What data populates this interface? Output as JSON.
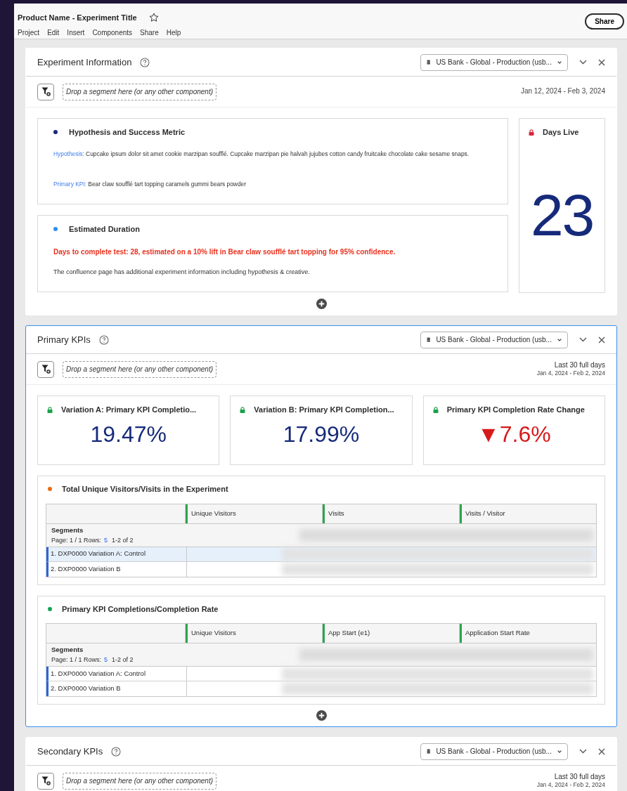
{
  "header": {
    "title": "Product Name - Experiment Title",
    "starred": false,
    "menu": [
      "Project",
      "Edit",
      "Insert",
      "Components",
      "Share",
      "Help"
    ],
    "share_button": "Share"
  },
  "panels": [
    {
      "kind": "info",
      "title": "Experiment Information",
      "selected": false,
      "data_source": "US Bank - Global - Production (usb...",
      "segment_drop": "Drop a segment here (or any other component)",
      "date_range": "Jan 12, 2024 - Feb 3, 2024",
      "cards": [
        {
          "title": "Hypothesis and Success Metric",
          "color": "#1b2a78",
          "lines": [
            {
              "label": "Hypothesis:",
              "text": "Cupcake ipsum dolor sit amet cookie marzipan soufflé. Cupcake marzipan pie halvah jujubes cotton candy fruitcake chocolate cake sesame snaps."
            },
            {
              "label": "Primary KPI:",
              "text": "Bear claw soufflé tart topping caramels gummi bears powder"
            }
          ]
        },
        {
          "title": "Estimated Duration",
          "color": "#2d8ff0",
          "alert": "Days to complete test: 28, estimated on a 10% lift in Bear claw soufflé tart topping for 95% confidence.",
          "note": "The confluence page has additional experiment information including hypothesis & creative."
        }
      ],
      "days_live": {
        "title": "Days Live",
        "value": "23"
      }
    },
    {
      "kind": "kpis",
      "title": "Primary KPIs",
      "selected": true,
      "data_source": "US Bank - Global - Production (usb...",
      "segment_drop": "Drop a segment here (or any other component)",
      "date_label": "Last 30 full days",
      "date_range": "Jan 4, 2024 - Feb 2, 2024",
      "metrics": [
        {
          "title": "Variation A: Primary KPI Completio...",
          "value": "19.47%",
          "color": "#162a7a"
        },
        {
          "title": "Variation B: Primary KPI Completion...",
          "value": "17.99%",
          "color": "#162a7a"
        },
        {
          "title": "Primary KPI Completion Rate Change",
          "value": "▼7.6%",
          "color": "#d71a1a"
        }
      ],
      "tables": [
        {
          "title": "Total Unique Visitors/Visits in the Experiment",
          "color": "#ee6a10",
          "columns": [
            "Unique Visitors",
            "Visits",
            "Visits / Visitor"
          ],
          "row_header": "Segments",
          "pager": "Page: 1 / 1 Rows:",
          "rows_count": "5",
          "range": "1-2 of 2",
          "rows": [
            {
              "label": "1.  DXP0000 Variation A: Control",
              "selected": true
            },
            {
              "label": "2.  DXP0000 Variation B",
              "selected": false
            }
          ]
        },
        {
          "title": "Primary KPI Completions/Completion Rate",
          "color": "#14a356",
          "columns": [
            "Unique Visitors",
            "App Start (e1)",
            "Application Start Rate"
          ],
          "row_header": "Segments",
          "pager": "Page: 1 / 1 Rows:",
          "rows_count": "5",
          "range": "1-2 of 2",
          "rows": [
            {
              "label": "1.  DXP0000 Variation A: Control",
              "selected": false
            },
            {
              "label": "2.  DXP0000 Variation B",
              "selected": false
            }
          ]
        }
      ]
    },
    {
      "kind": "empty",
      "title": "Secondary KPIs",
      "selected": false,
      "data_source": "US Bank - Global - Production (usb...",
      "segment_drop": "Drop a segment here (or any other component)",
      "date_label": "Last 30 full days",
      "date_range": "Jan 4, 2024 - Feb 2, 2024"
    }
  ]
}
